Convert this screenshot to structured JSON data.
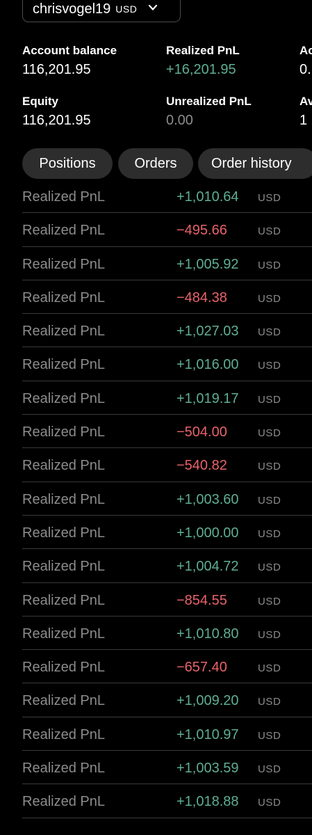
{
  "account": {
    "name": "chrisvogel19",
    "currency": "USD"
  },
  "stats": {
    "account_balance": {
      "label": "Account balance",
      "value": "116,201.95"
    },
    "realized_pnl": {
      "label": "Realized PnL",
      "value": "+16,201.95"
    },
    "third_col_top": {
      "label": "Ac",
      "value": "0."
    },
    "equity": {
      "label": "Equity",
      "value": "116,201.95"
    },
    "unrealized_pnl": {
      "label": "Unrealized PnL",
      "value": "0.00"
    },
    "third_col_bottom": {
      "label": "Av",
      "value": "1"
    }
  },
  "tabs": [
    {
      "label": "Positions"
    },
    {
      "label": "Orders"
    },
    {
      "label": "Order history"
    }
  ],
  "history": {
    "row_label": "Realized PnL",
    "currency": "USD",
    "amounts": [
      "+1,010.64",
      "−495.66",
      "+1,005.92",
      "−484.38",
      "+1,027.03",
      "+1,016.00",
      "+1,019.17",
      "−504.00",
      "−540.82",
      "+1,003.60",
      "+1,000.00",
      "+1,004.72",
      "−854.55",
      "+1,010.80",
      "−657.40",
      "+1,009.20",
      "+1,010.97",
      "+1,003.59",
      "+1,018.88"
    ]
  },
  "colors": {
    "positive": "#5fae95",
    "negative": "#e8636b",
    "muted": "#8c8c8c",
    "background": "#000000",
    "tab_background": "#2d2d2d"
  }
}
